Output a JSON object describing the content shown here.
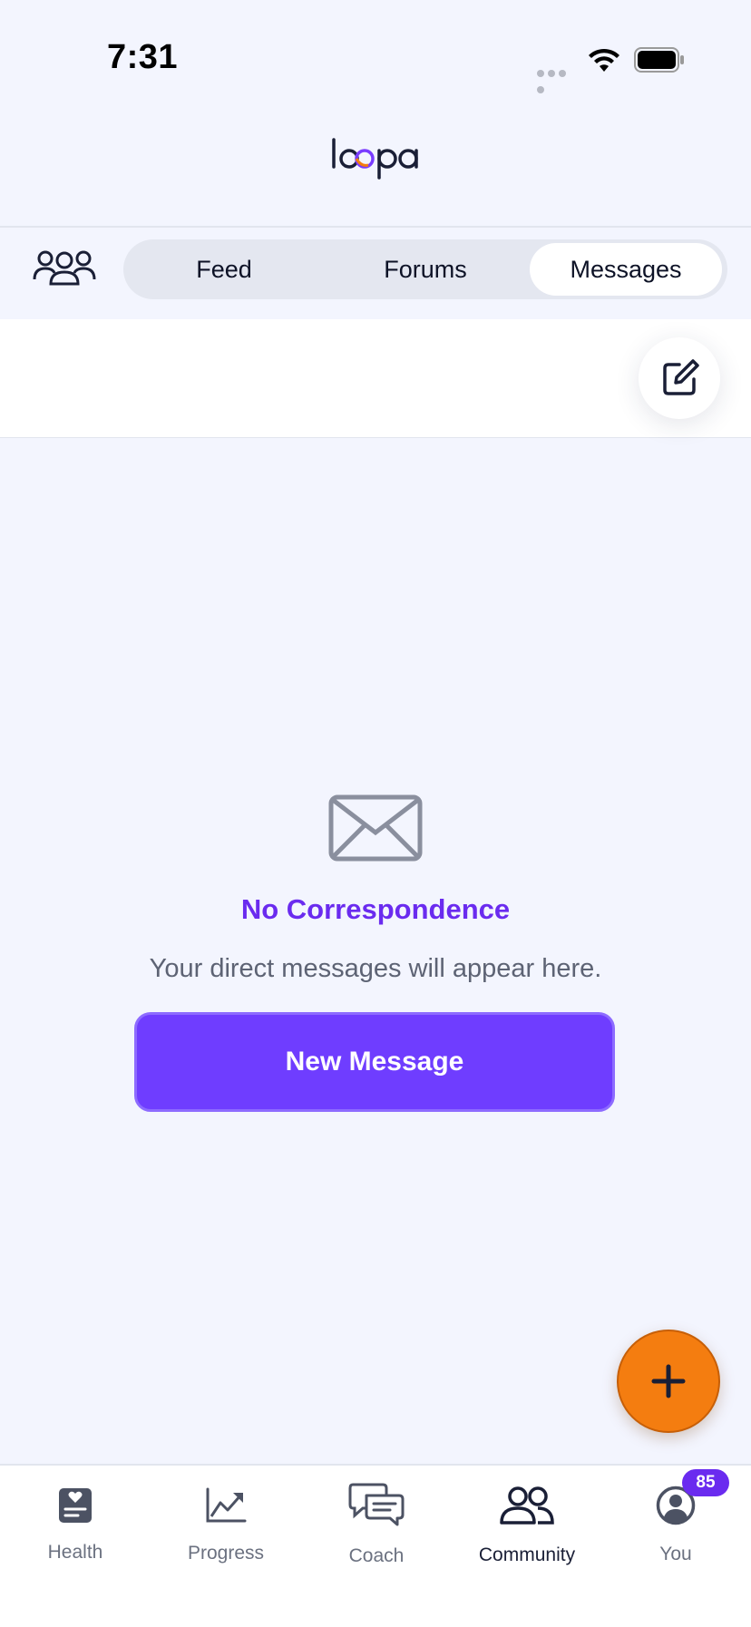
{
  "status_bar": {
    "time": "7:31"
  },
  "app": {
    "logo_text": "loopa"
  },
  "header": {
    "tabs": [
      {
        "label": "Feed",
        "active": false
      },
      {
        "label": "Forums",
        "active": false
      },
      {
        "label": "Messages",
        "active": true
      }
    ]
  },
  "empty_state": {
    "icon": "envelope-icon",
    "title": "No Correspondence",
    "subtitle": "Your direct messages will appear here.",
    "button_label": "New Message"
  },
  "bottom_nav": {
    "items": [
      {
        "label": "Health",
        "icon": "health-icon"
      },
      {
        "label": "Progress",
        "icon": "progress-chart-icon"
      },
      {
        "label": "Coach",
        "icon": "chat-bubbles-icon"
      },
      {
        "label": "Community",
        "icon": "people-icon",
        "active": true
      },
      {
        "label": "You",
        "icon": "profile-icon",
        "badge": "85"
      }
    ]
  },
  "colors": {
    "accent": "#6a2bef",
    "button": "#6f3dff",
    "fab": "#f47d10",
    "background": "#f3f5fe"
  }
}
